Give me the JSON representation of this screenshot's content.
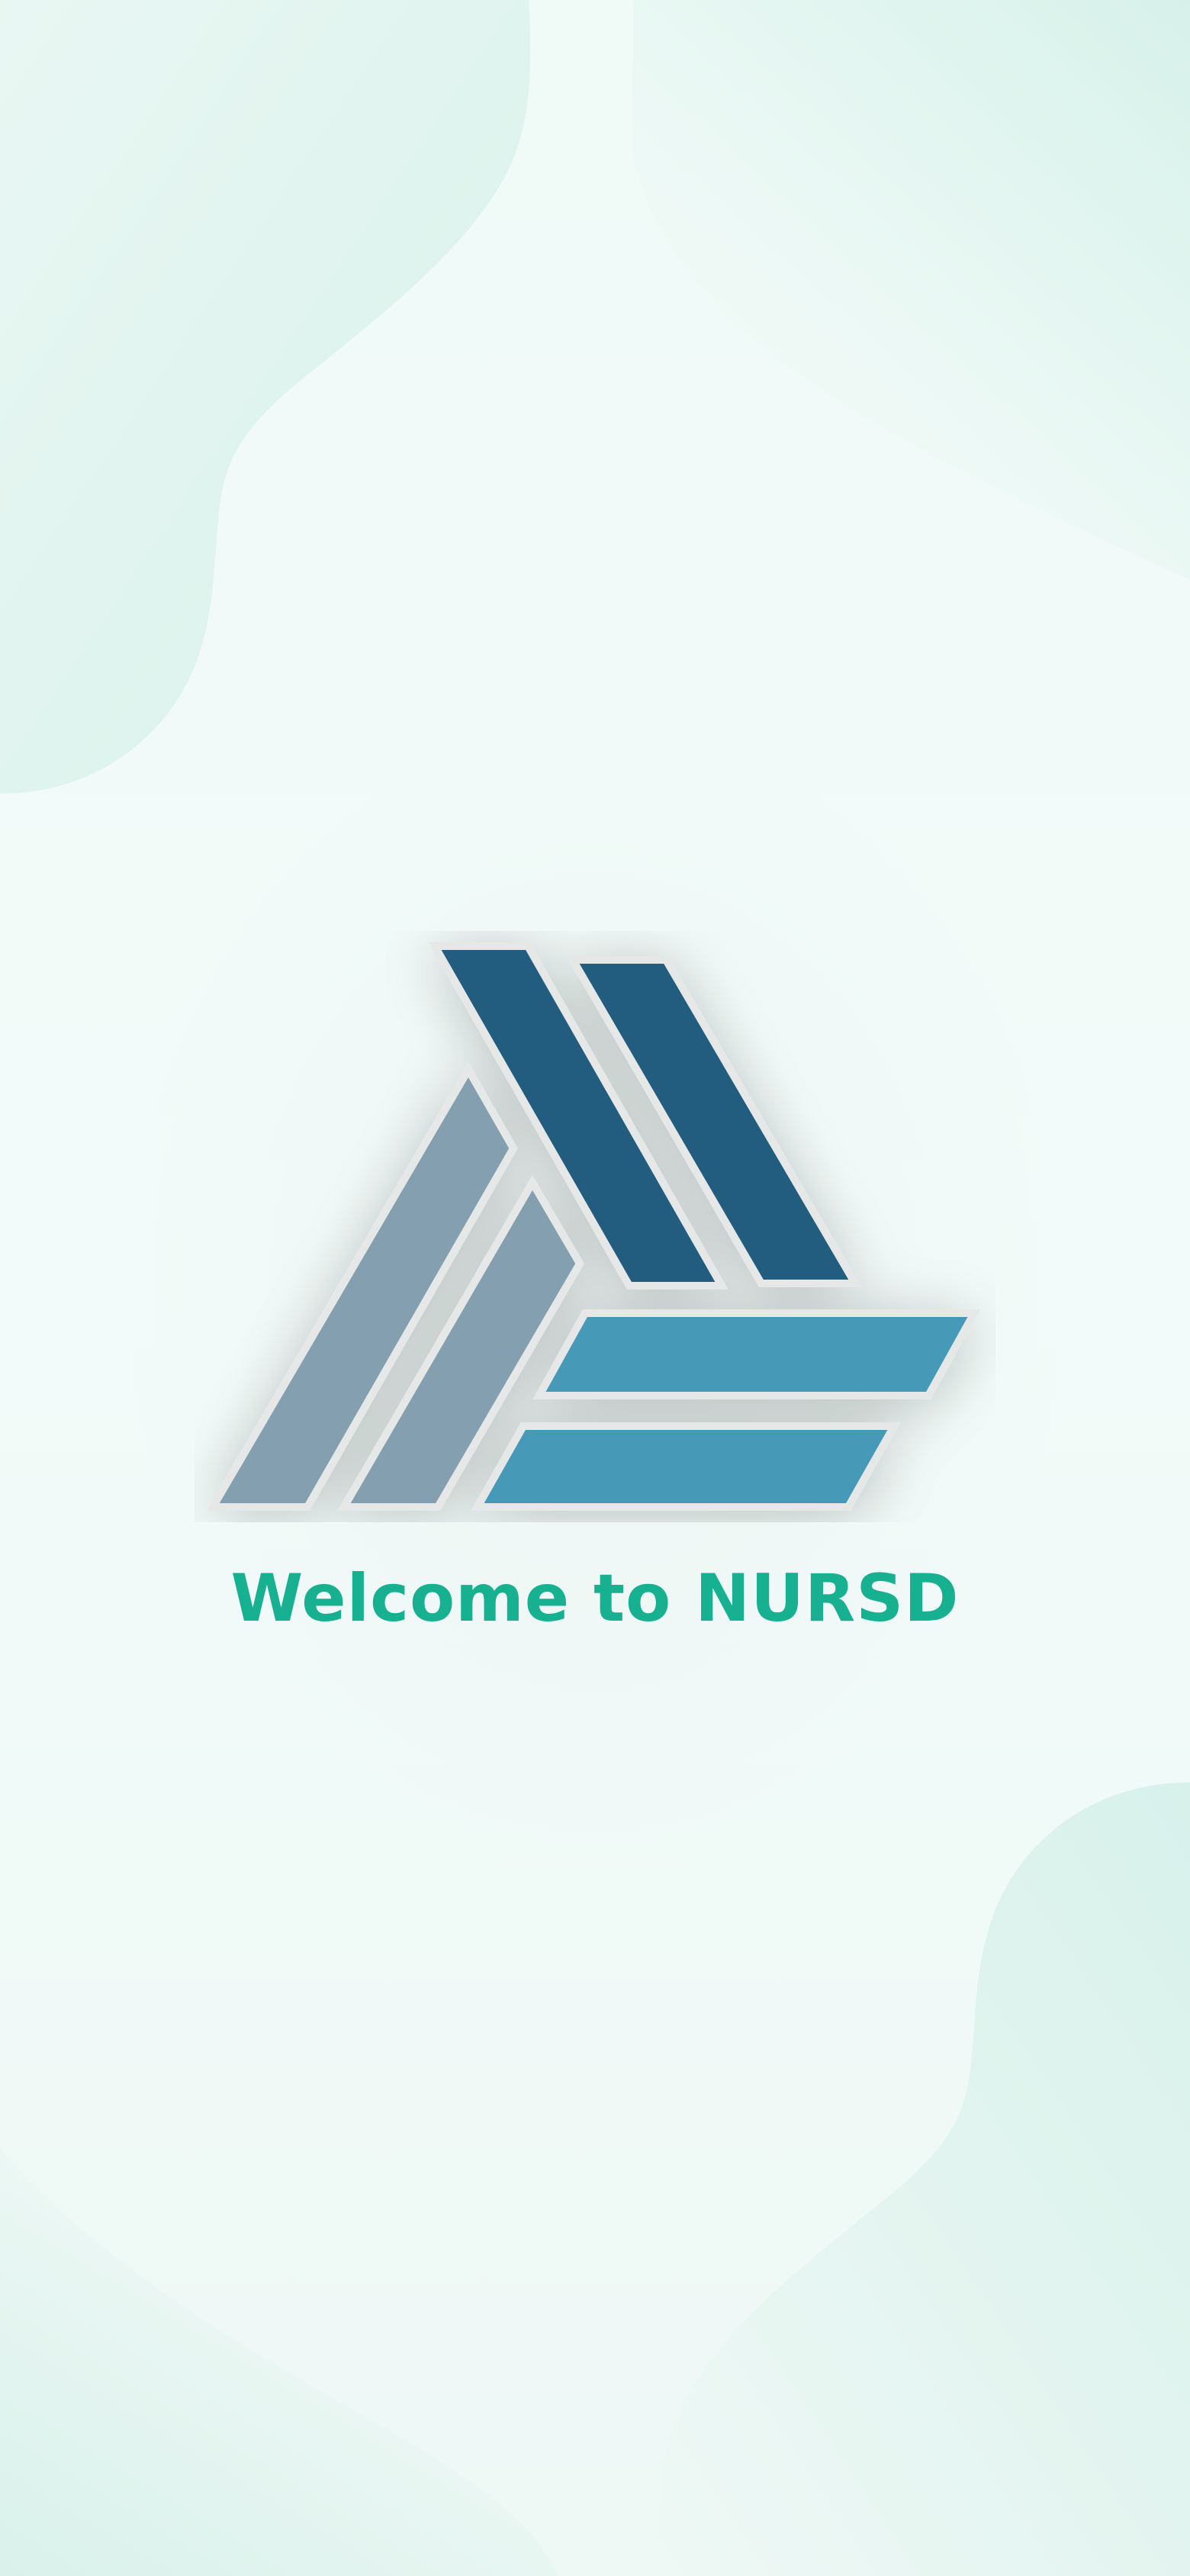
{
  "screen": {
    "welcome_text": "Welcome to NURSD"
  },
  "logo": {
    "name": "nursd-logo-icon",
    "colors": {
      "dark_blue": "#215c7e",
      "slate_blue": "#84a0b0",
      "teal_blue": "#4699b8",
      "outline": "#e6e8e8"
    }
  },
  "colors": {
    "background": "#f1faf8",
    "blob": "#d6f0ea",
    "welcome_text": "#17b191"
  }
}
